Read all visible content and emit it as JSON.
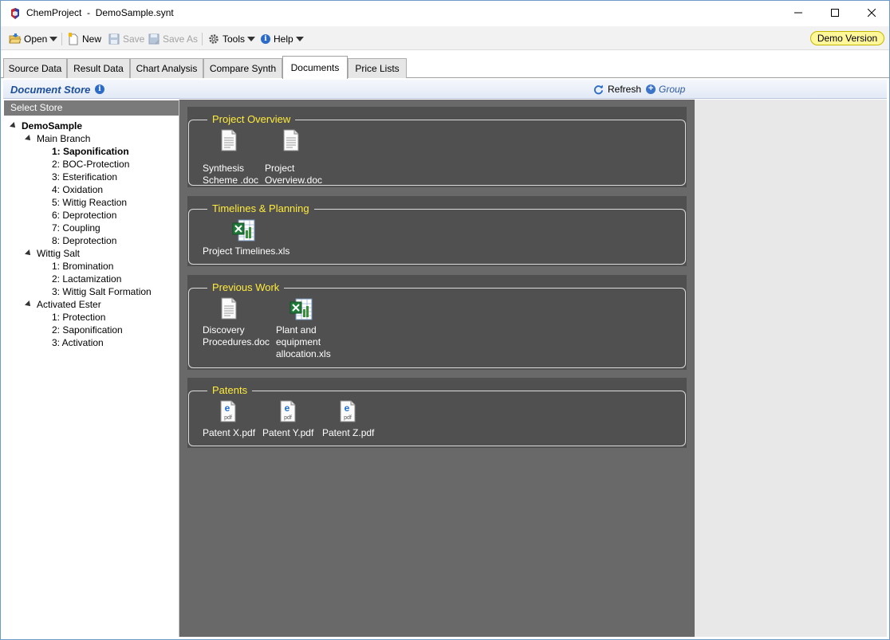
{
  "window": {
    "title": "ChemProject  -  DemoSample.synt",
    "controls": {
      "minimize": "—",
      "maximize": "☐",
      "close": "✕"
    }
  },
  "toolbar": {
    "open_label": "Open",
    "new_label": "New",
    "save_label": "Save",
    "save_as_label": "Save As",
    "tools_label": "Tools",
    "help_label": "Help",
    "demo_badge": "Demo Version"
  },
  "tabs": [
    {
      "label": "Source Data"
    },
    {
      "label": "Result Data"
    },
    {
      "label": "Chart Analysis"
    },
    {
      "label": "Compare Synth"
    },
    {
      "label": "Documents"
    },
    {
      "label": "Price Lists"
    }
  ],
  "active_tab": "Documents",
  "document_store": {
    "title": "Document Store",
    "refresh_label": "Refresh",
    "group_label": "Group"
  },
  "store_panel": {
    "header": "Select Store",
    "tree": {
      "root": "DemoSample",
      "branches": [
        {
          "label": "Main Branch",
          "items": [
            "1: Saponification",
            "2: BOC-Protection",
            "3: Esterification",
            "4: Oxidation",
            "5: Wittig Reaction",
            "6: Deprotection",
            "7: Coupling",
            "8: Deprotection"
          ]
        },
        {
          "label": "Wittig Salt",
          "items": [
            "1: Bromination",
            "2: Lactamization",
            "3: Wittig Salt Formation"
          ]
        },
        {
          "label": "Activated Ester",
          "items": [
            "1: Protection",
            "2: Saponification",
            "3: Activation"
          ]
        }
      ],
      "selected": "1: Saponification"
    }
  },
  "groups": [
    {
      "title": "Project Overview",
      "docs": [
        {
          "name": "Synthesis\nScheme .doc",
          "type": "doc"
        },
        {
          "name": "Project\nOverview.doc",
          "type": "doc"
        }
      ]
    },
    {
      "title": "Timelines & Planning",
      "docs": [
        {
          "name": "Project Timelines.xls",
          "type": "xls"
        }
      ]
    },
    {
      "title": "Previous Work",
      "docs": [
        {
          "name": "Discovery\nProcedures.doc",
          "type": "doc"
        },
        {
          "name": "Plant and\nequipment\nallocation.xls",
          "type": "xls"
        }
      ]
    },
    {
      "title": "Patents",
      "docs": [
        {
          "name": "Patent X.pdf",
          "type": "pdf"
        },
        {
          "name": "Patent Y.pdf",
          "type": "pdf"
        },
        {
          "name": "Patent Z.pdf",
          "type": "pdf"
        }
      ]
    }
  ],
  "colors": {
    "group_title": "#ffeb3b",
    "dark_bg": "#696969",
    "group_bg": "#505050",
    "accent": "#1d4f99",
    "demo_badge": "#fff799"
  }
}
